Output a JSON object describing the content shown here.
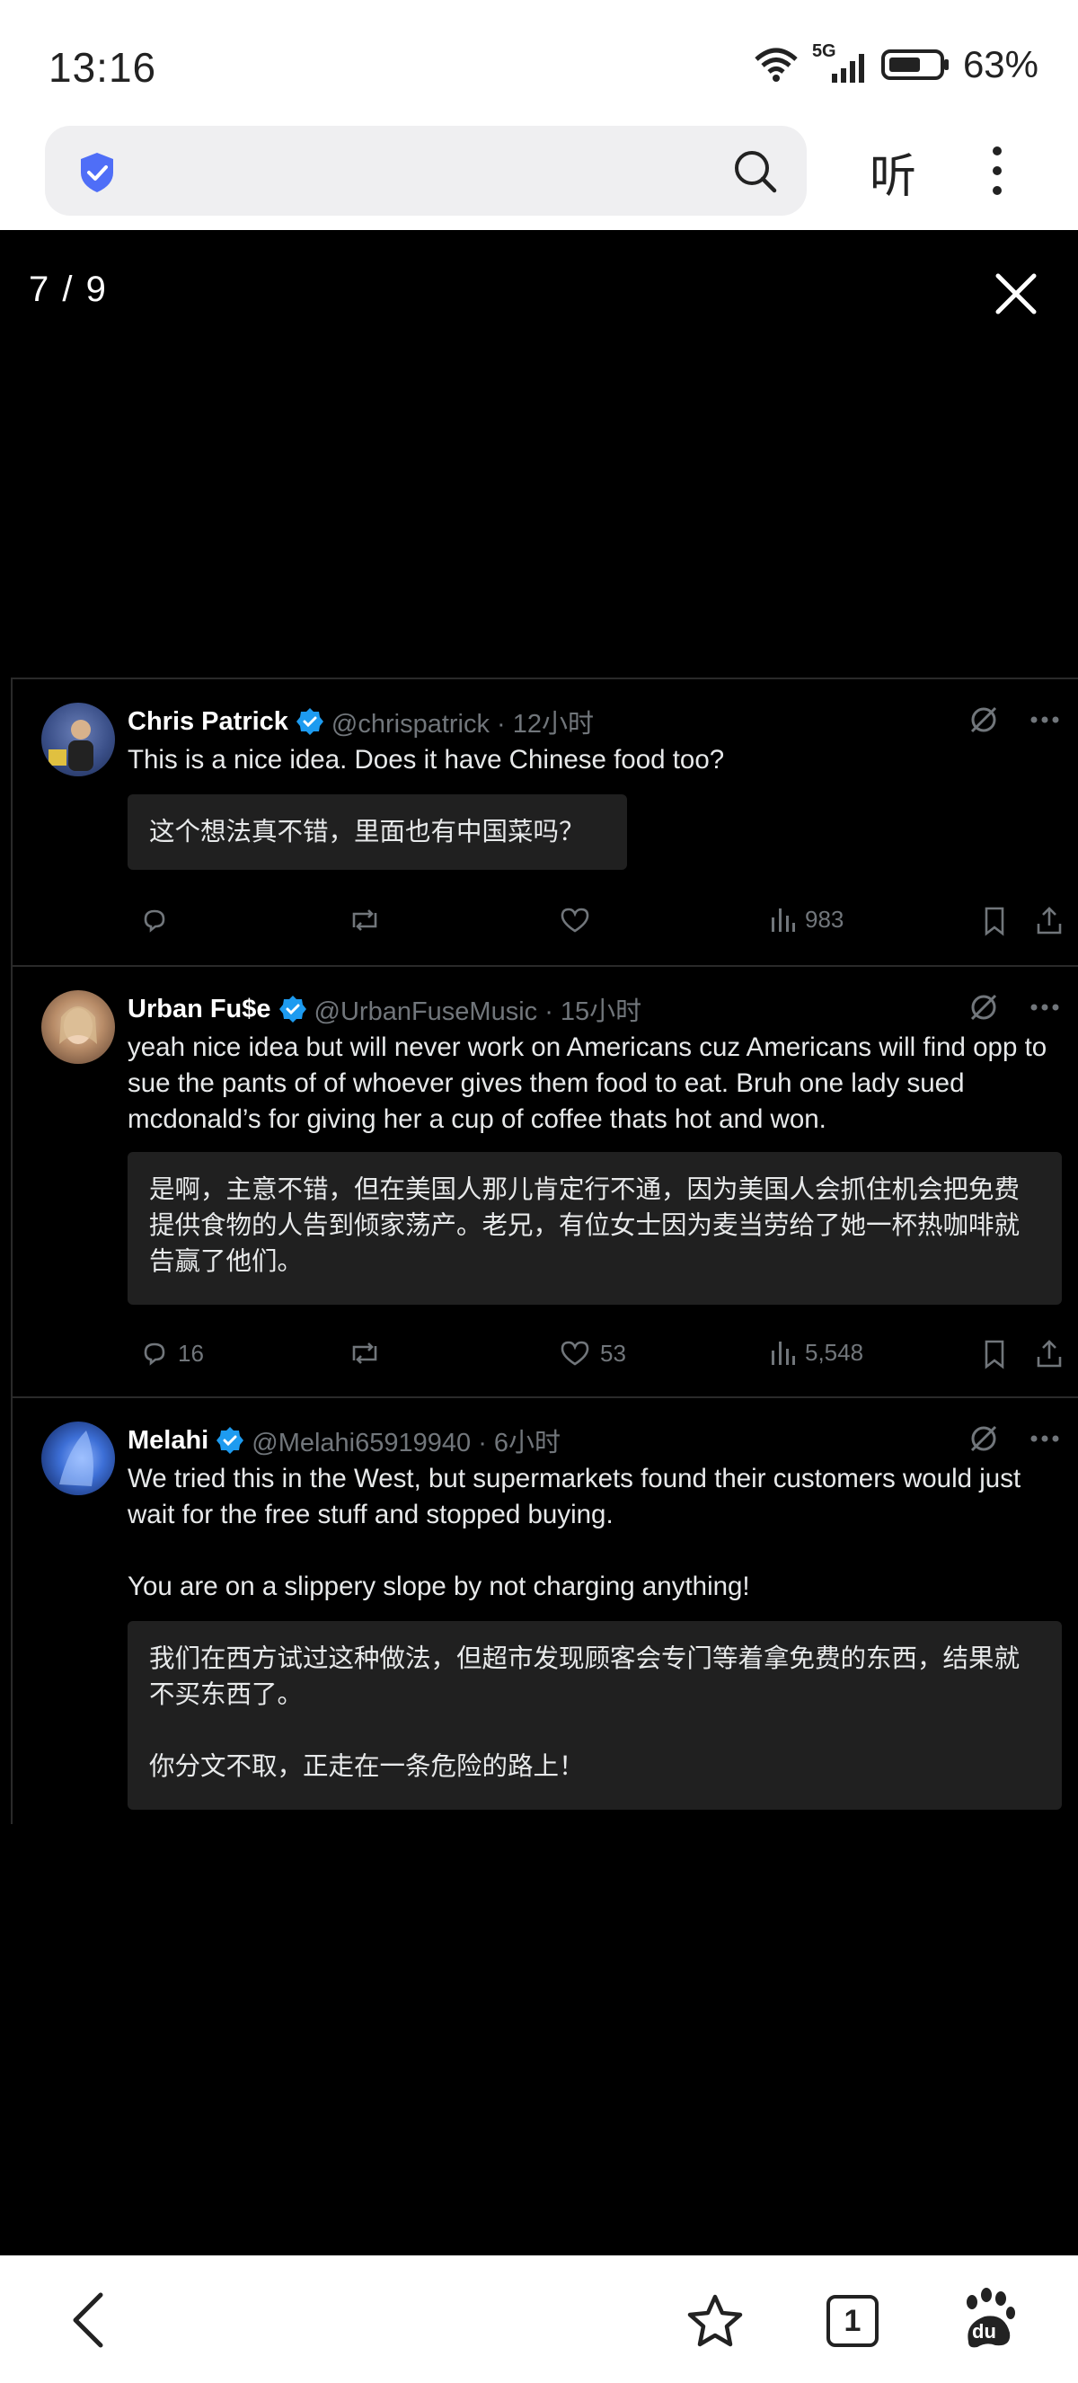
{
  "status_bar": {
    "time": "13:16",
    "network": "5G",
    "battery": "63%"
  },
  "browser": {
    "listen_label": "听"
  },
  "viewer": {
    "counter": "7 / 9"
  },
  "tweets": [
    {
      "name": "Chris Patrick",
      "handle": "@chrispatrick · 12小时",
      "text": "This is a nice idea. Does it have Chinese food too?",
      "translation": "这个想法真不错，里面也有中国菜吗？",
      "replies": "",
      "likes": "",
      "views": "983"
    },
    {
      "name": "Urban Fu$e",
      "handle": "@UrbanFuseMusic · 15小时",
      "text": "yeah nice idea but will never work on Americans cuz Americans will find opp to sue the pants of of whoever gives them food to eat. Bruh one lady sued mcdonald’s for giving her a cup of coffee thats hot and won.",
      "translation": "是啊，主意不错，但在美国人那儿肯定行不通，因为美国人会抓住机会把免费提供食物的人告到倾家荡产。老兄，有位女士因为麦当劳给了她一杯热咖啡就告赢了他们。",
      "replies": "16",
      "likes": "53",
      "views": "5,548"
    },
    {
      "name": "Melahi",
      "handle": "@Melahi65919940 · 6小时",
      "text": "We tried this in the West, but supermarkets found their customers would just wait for the free stuff and stopped buying.\n\nYou are on a slippery slope by not charging anything!",
      "translation": "我们在西方试过这种做法，但超市发现顾客会专门等着拿免费的东西，结果就不买东西了。\n\n你分文不取，正走在一条危险的路上！"
    }
  ],
  "bottom_nav": {
    "tabs_count": "1",
    "baidu_label": "du"
  },
  "colors": {
    "verified": "#1d9bf0",
    "shield": "#4f6ef7"
  }
}
